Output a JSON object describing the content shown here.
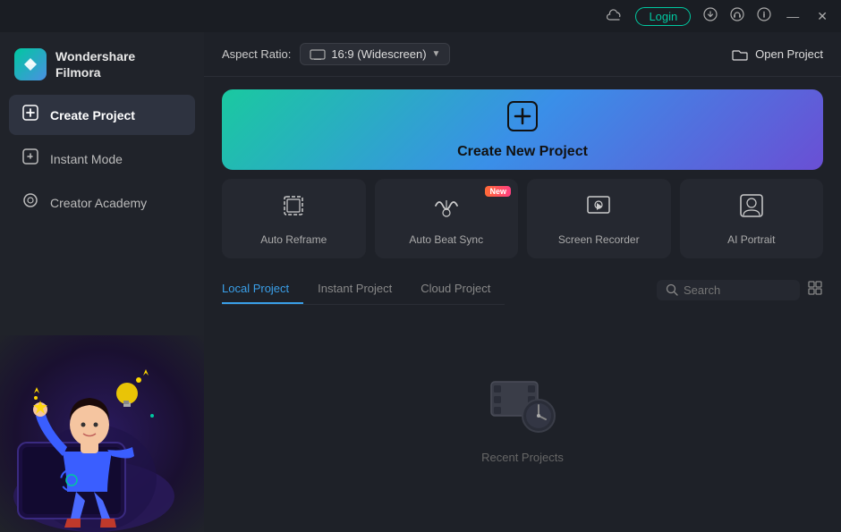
{
  "app": {
    "name": "Wondershare",
    "product": "Filmora"
  },
  "titlebar": {
    "login_label": "Login",
    "icons": [
      "cloud",
      "download",
      "headphone",
      "info",
      "minimize",
      "close"
    ]
  },
  "sidebar": {
    "items": [
      {
        "id": "create-project",
        "label": "Create Project",
        "icon": "⊞",
        "active": true
      },
      {
        "id": "instant-mode",
        "label": "Instant Mode",
        "icon": "⊡",
        "active": false
      },
      {
        "id": "creator-academy",
        "label": "Creator Academy",
        "icon": "◎",
        "active": false
      }
    ]
  },
  "content_header": {
    "aspect_ratio_label": "Aspect Ratio:",
    "aspect_value": "16:9 (Widescreen)",
    "open_project_label": "Open Project"
  },
  "create_banner": {
    "label": "Create New Project"
  },
  "feature_cards": [
    {
      "id": "auto-reframe",
      "label": "Auto Reframe",
      "icon": "⬚",
      "badge": null
    },
    {
      "id": "auto-beat-sync",
      "label": "Auto Beat Sync",
      "icon": "≋",
      "badge": "New"
    },
    {
      "id": "screen-recorder",
      "label": "Screen Recorder",
      "icon": "⏺",
      "badge": null
    },
    {
      "id": "ai-portrait",
      "label": "AI Portrait",
      "icon": "🖼",
      "badge": null
    }
  ],
  "project_tabs": [
    {
      "id": "local",
      "label": "Local Project",
      "active": true
    },
    {
      "id": "instant",
      "label": "Instant Project",
      "active": false
    },
    {
      "id": "cloud",
      "label": "Cloud Project",
      "active": false
    }
  ],
  "search": {
    "placeholder": "Search"
  },
  "empty_state": {
    "label": "Recent Projects"
  }
}
